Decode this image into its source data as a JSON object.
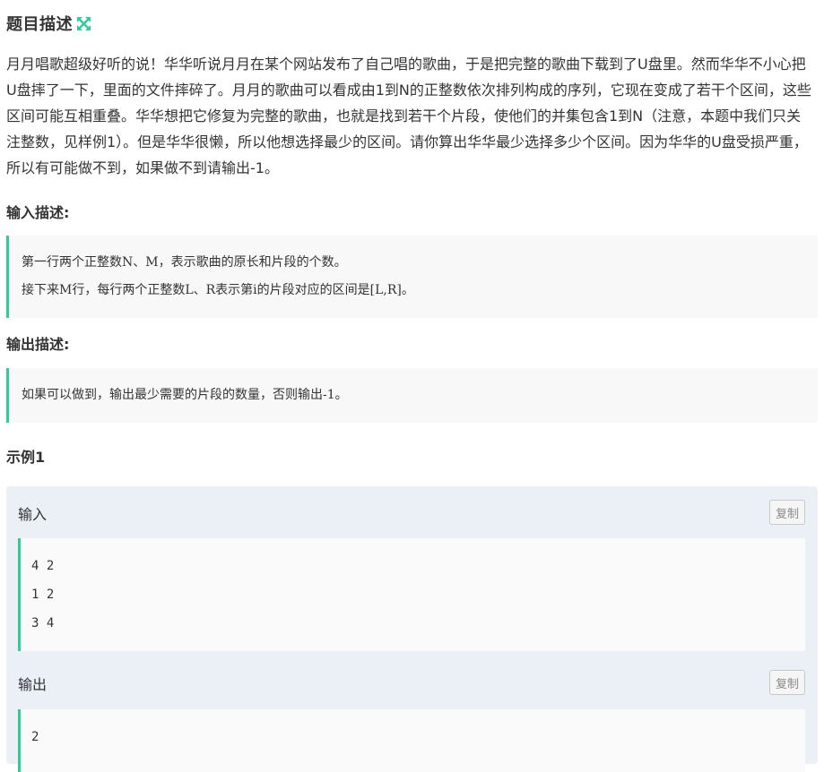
{
  "problem": {
    "title": "题目描述",
    "description": "月月唱歌超级好听的说！华华听说月月在某个网站发布了自己唱的歌曲，于是把完整的歌曲下载到了U盘里。然而华华不小心把U盘摔了一下，里面的文件摔碎了。月月的歌曲可以看成由1到N的正整数依次排列构成的序列，它现在变成了若干个区间，这些区间可能互相重叠。华华想把它修复为完整的歌曲，也就是找到若干个片段，使他们的并集包含1到N（注意，本题中我们只关注整数，见样例1）。但是华华很懒，所以他想选择最少的区间。请你算出华华最少选择多少个区间。因为华华的U盘受损严重，所以有可能做不到，如果做不到请输出-1。"
  },
  "input_section": {
    "heading": "输入描述:",
    "lines": [
      "第一行两个正整数N、M，表示歌曲的原长和片段的个数。",
      "接下来M行，每行两个正整数L、R表示第i的片段对应的区间是[L,R]。"
    ]
  },
  "output_section": {
    "heading": "输出描述:",
    "lines": [
      "如果可以做到，输出最少需要的片段的数量，否则输出-1。"
    ]
  },
  "example": {
    "heading": "示例1",
    "input_label": "输入",
    "output_label": "输出",
    "copy_label": "复制",
    "input_lines": [
      "4 2",
      "1 2",
      "3 4"
    ],
    "output_lines": [
      "2"
    ]
  },
  "icons": {
    "expand": "expand-arrows-icon"
  },
  "colors": {
    "accent": "#32ca99",
    "example_bg": "#ebf0f7",
    "block_bg": "#f8f8f8"
  }
}
